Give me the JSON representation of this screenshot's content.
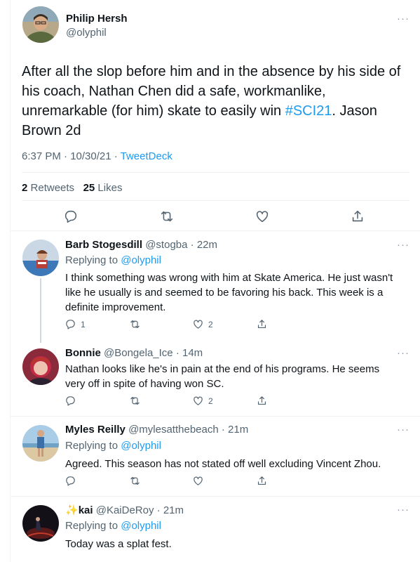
{
  "main_tweet": {
    "name": "Philip Hersh",
    "handle": "@olyphil",
    "text_before": "After all the slop before him and in the absence by his side of his coach, Nathan Chen did a safe, workmanlike, unremarkable (for him) skate to easily win ",
    "hashtag": "#SCI21",
    "text_after": ".  Jason Brown 2d",
    "time": "6:37 PM · 10/30/21 · ",
    "source": "TweetDeck",
    "retweets_count": "2",
    "retweets_label": "Retweets",
    "likes_count": "25",
    "likes_label": "Likes",
    "more": "···"
  },
  "replies": [
    {
      "name": "Barb Stogesdill",
      "handle": "@stogba",
      "time": "22m",
      "replying_label": "Replying to ",
      "replying_to": "@olyphil",
      "text": "I think something was wrong with him at Skate America. He just wasn't like he usually is and seemed to be favoring his back. This week is a definite improvement.",
      "reply_count": "1",
      "like_count": "2"
    },
    {
      "name": "Bonnie",
      "handle": "@Bongela_Ice",
      "time": "14m",
      "text": "Nathan looks like he's in pain at the end of his programs. He seems very off in spite of having won SC.",
      "reply_count": "",
      "like_count": "2"
    },
    {
      "name": "Myles Reilly",
      "handle": "@mylesatthebeach",
      "time": "21m",
      "replying_label": "Replying to ",
      "replying_to": "@olyphil",
      "text": "Agreed.  This season has not stated off well excluding Vincent Zhou.",
      "reply_count": "",
      "like_count": ""
    },
    {
      "name_prefix": "✨",
      "name": "kai",
      "handle": "@KaiDeRoy",
      "time": "21m",
      "replying_label": "Replying to ",
      "replying_to": "@olyphil",
      "text": "Today was a splat fest."
    }
  ],
  "sep": " · ",
  "colors": {
    "link": "#1d9bf0",
    "muted": "#536471",
    "text": "#0f1419",
    "divider": "#eff3f4"
  },
  "icons": [
    "reply-icon",
    "retweet-icon",
    "like-icon",
    "share-icon",
    "more-icon"
  ]
}
